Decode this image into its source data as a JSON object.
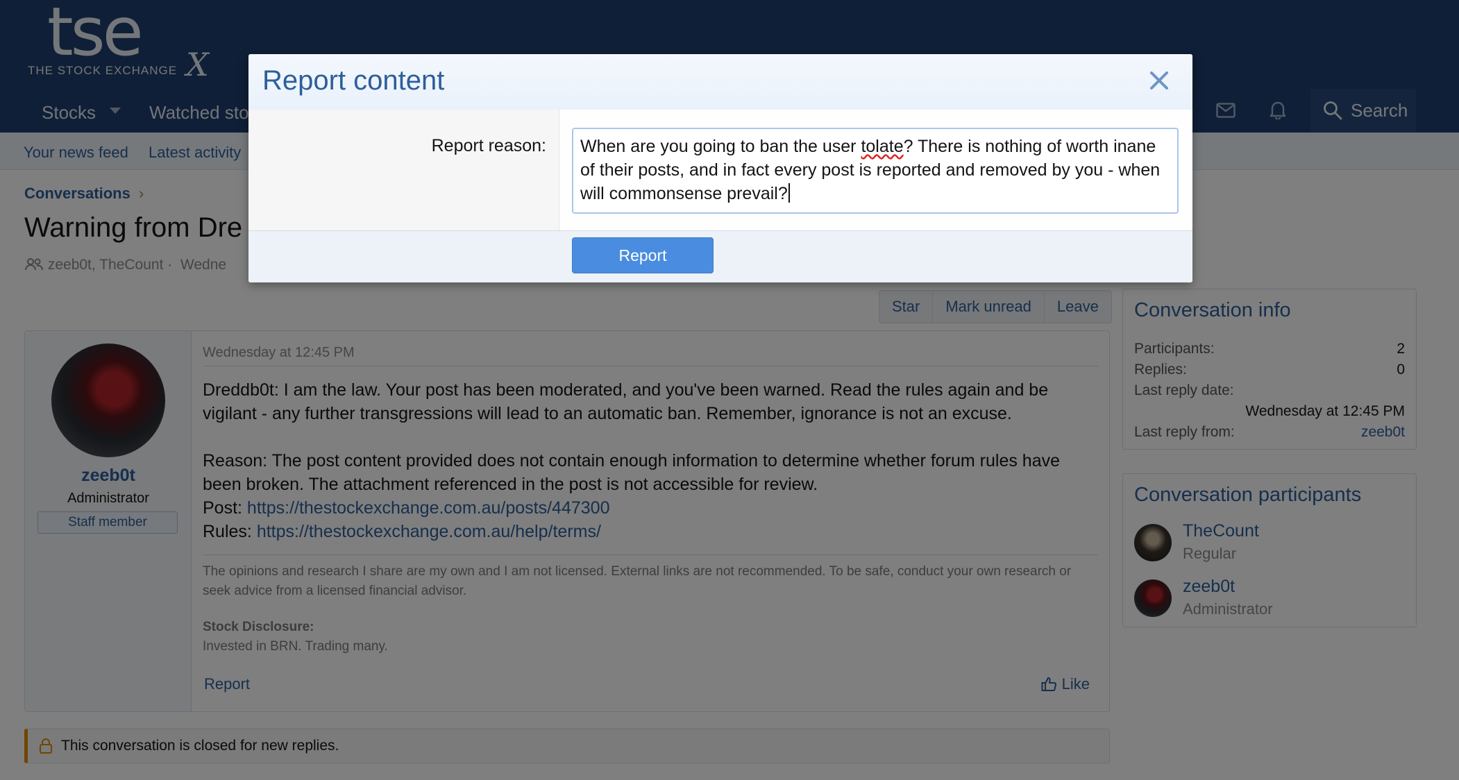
{
  "header": {
    "logo_mark": "tse",
    "logo_tagline": "THE STOCK EXCHANGE",
    "logo_x": "X",
    "nav": {
      "stocks": "Stocks",
      "watched": "Watched sto"
    },
    "search_label": "Search"
  },
  "subnav": {
    "news_feed": "Your news feed",
    "latest_activity": "Latest activity"
  },
  "breadcrumb": {
    "conversations": "Conversations",
    "separator": "›"
  },
  "page": {
    "title": "Warning from Dre",
    "meta": "zeeb0t, TheCount ·  Wedne"
  },
  "actions": {
    "star": "Star",
    "mark_unread": "Mark unread",
    "leave": "Leave"
  },
  "message": {
    "user": {
      "name": "zeeb0t",
      "role": "Administrator",
      "badge": "Staff member"
    },
    "date": "Wednesday at 12:45 PM",
    "para1": "Dreddb0t: I am the law. Your post has been moderated, and you've been warned. Read the rules again and be vigilant - any further transgressions will lead to an automatic ban. Remember, ignorance is not an excuse.",
    "reason": "Reason: The post content provided does not contain enough information to determine whether forum rules have been broken. The attachment referenced in the post is not accessible for review.",
    "post_label": "Post: ",
    "post_link": "https://thestockexchange.com.au/posts/447300",
    "rules_label": "Rules: ",
    "rules_link": "https://thestockexchange.com.au/help/terms/",
    "signature": "The opinions and research I share are my own and I am not licensed. External links are not recommended. To be safe, conduct your own research or seek advice from a licensed financial advisor.",
    "disclosure_heading": "Stock Disclosure:",
    "disclosure_text": "Invested in BRN. Trading many.",
    "report": "Report",
    "like": "Like"
  },
  "closed_notice": "This conversation is closed for new replies.",
  "conversation_info": {
    "title": "Conversation info",
    "participants_label": "Participants:",
    "participants_value": "2",
    "replies_label": "Replies:",
    "replies_value": "0",
    "last_reply_date_label": "Last reply date:",
    "last_reply_date_value": "Wednesday at 12:45 PM",
    "last_reply_from_label": "Last reply from:",
    "last_reply_from_value": "zeeb0t"
  },
  "participants": {
    "title": "Conversation participants",
    "items": [
      {
        "name": "TheCount",
        "role": "Regular"
      },
      {
        "name": "zeeb0t",
        "role": "Administrator"
      }
    ]
  },
  "dialog": {
    "title": "Report content",
    "reason_label": "Report reason:",
    "reason_before": "When are you going to ban the user ",
    "reason_misspelled": "tolate",
    "reason_after": "? There is nothing of worth inane of their posts, and in fact every post is reported and removed by you - when will commonsense prevail?",
    "submit": "Report"
  },
  "icons": {
    "nav_caret": "chevron-down-icon",
    "mail": "mail-icon",
    "bell": "bell-icon",
    "search": "search-icon",
    "users": "users-icon",
    "clock": "clock-icon",
    "breadcrumb": "chevron-right-icon",
    "like": "thumbs-up-icon",
    "lock": "lock-icon",
    "close": "close-icon"
  },
  "colors": {
    "header_bg": "#1f3f6e",
    "link": "#2d5e9b",
    "button_primary": "#4a8de0",
    "notice_accent": "#e08a00"
  }
}
